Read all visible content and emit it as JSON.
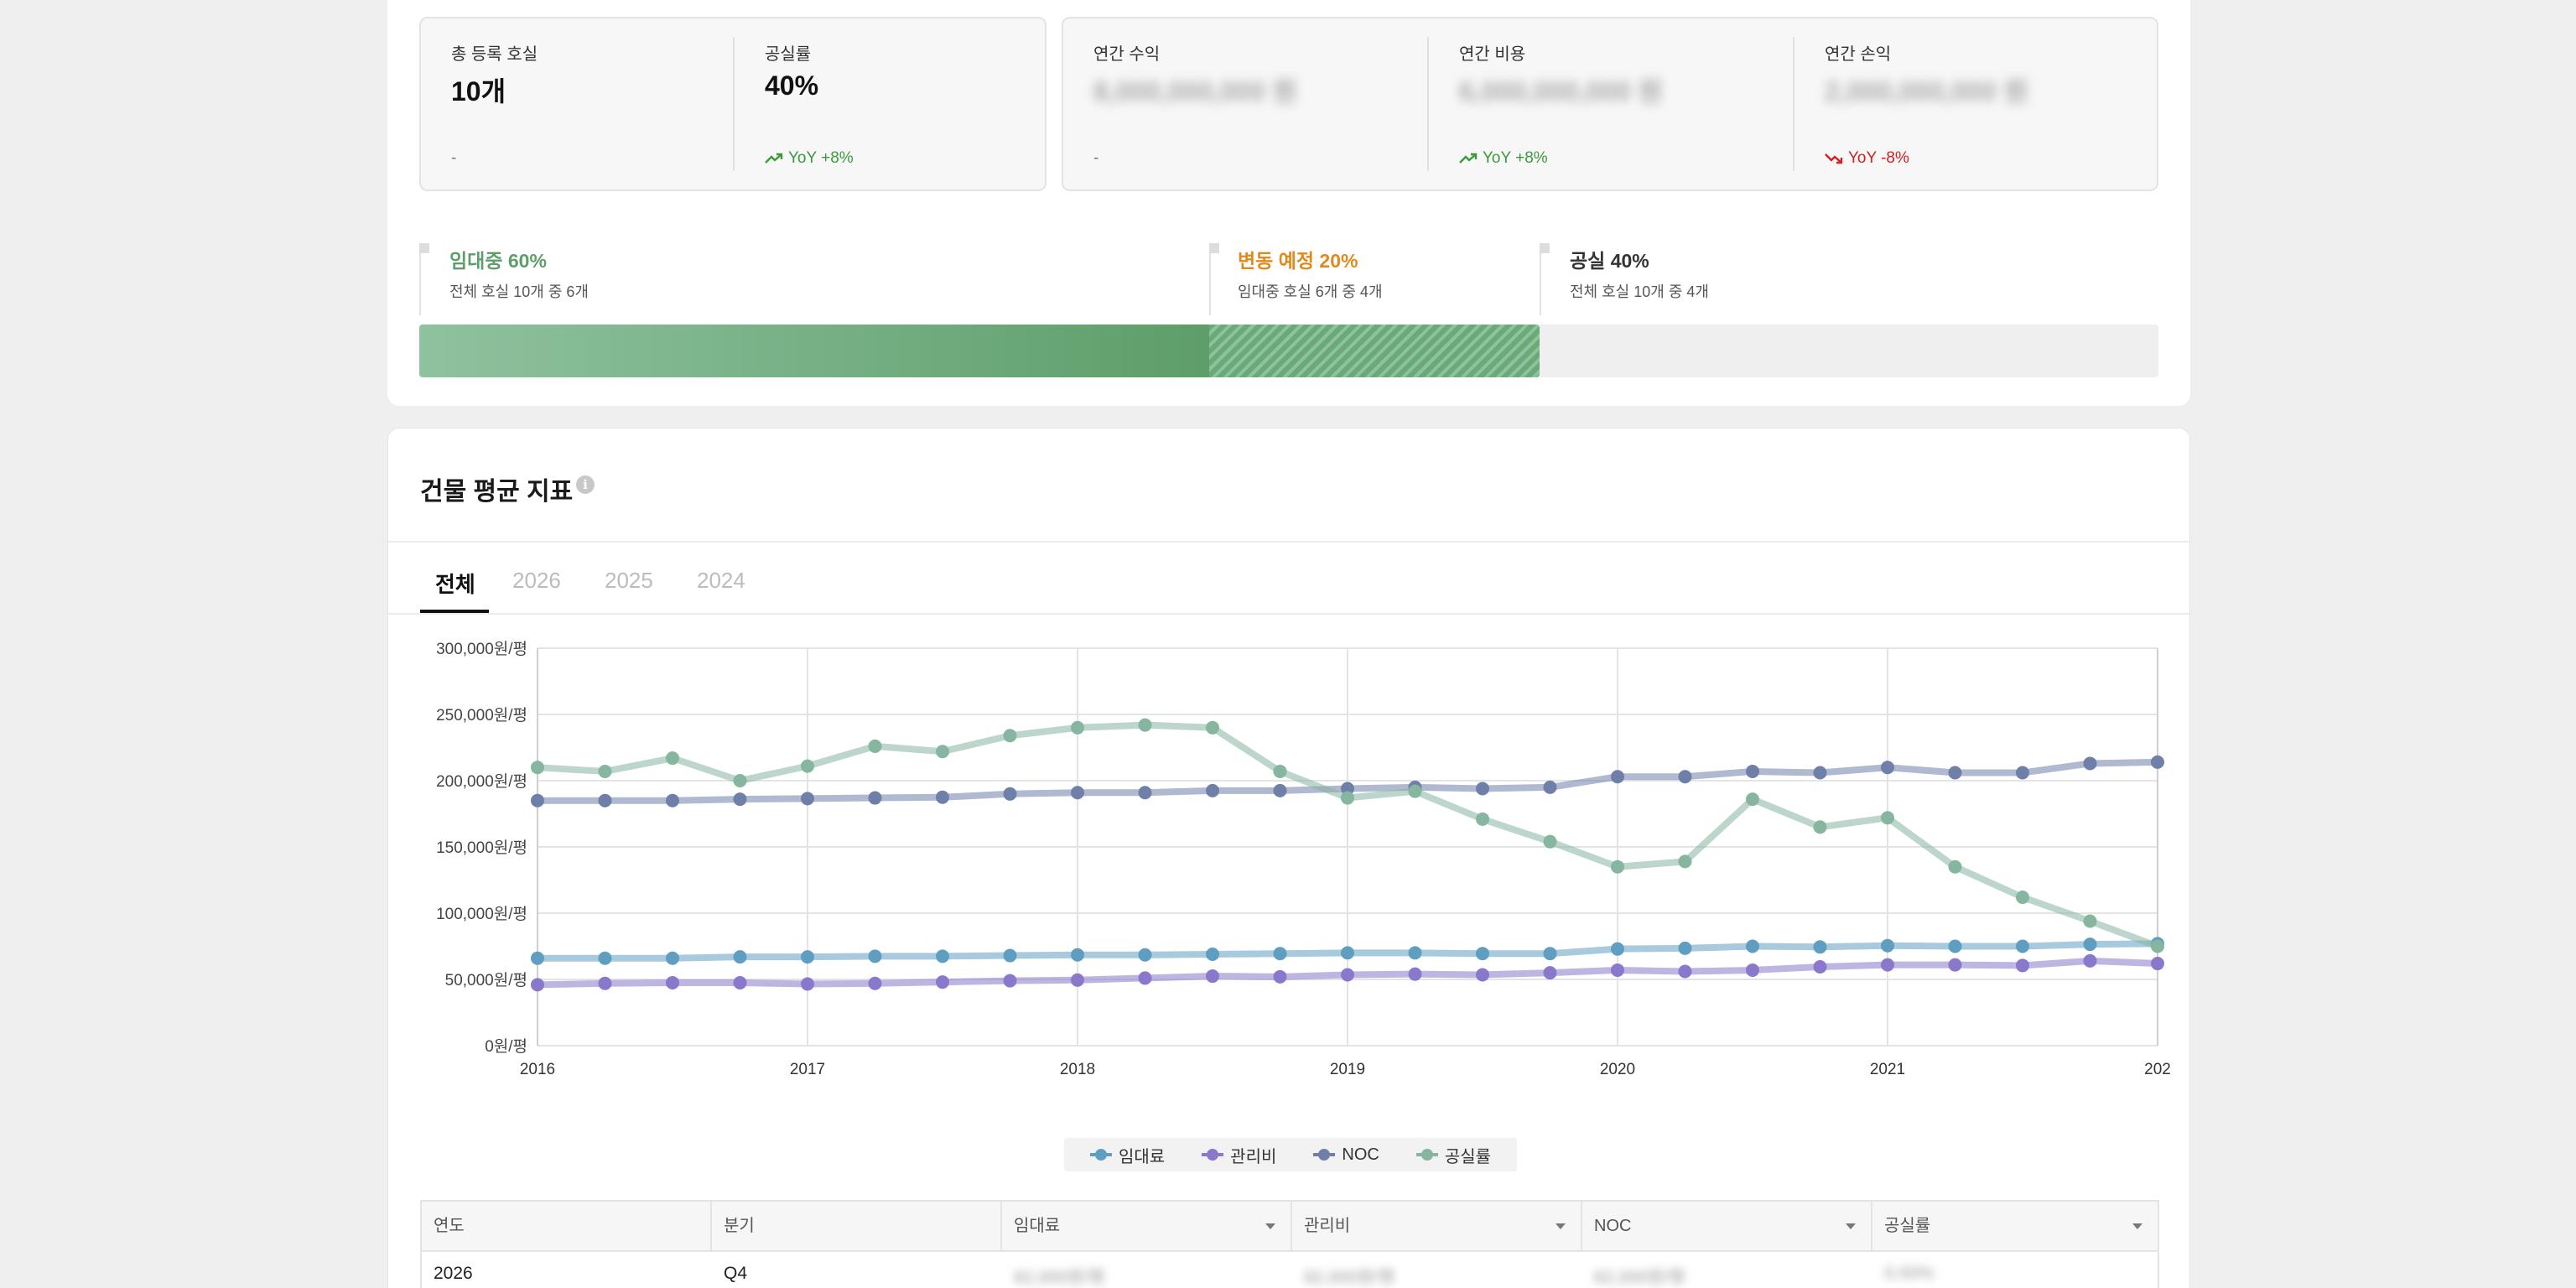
{
  "summary": {
    "registered_units_label": "총 등록 호실",
    "registered_units_value": "10개",
    "registered_units_foot": "-",
    "vacancy_label": "공실률",
    "vacancy_value": "40%",
    "vacancy_foot": "YoY +8%",
    "annual_income_label": "연간 수익",
    "annual_income_value": "8,000,000,000 원",
    "annual_income_foot": "-",
    "annual_cost_label": "연간 비용",
    "annual_cost_value": "6,000,000,000 원",
    "annual_cost_foot": "YoY +8%",
    "annual_pl_label": "연간 손익",
    "annual_pl_value": "2,000,000,000 원",
    "annual_pl_foot": "YoY -8%"
  },
  "occupancy": {
    "leased_title": "임대중 60%",
    "leased_sub": "전체 호실 10개 중 6개",
    "leased_pct": 60,
    "changing_title": "변동 예정 20%",
    "changing_sub": "임대중 호실 6개 중 4개",
    "changing_pct": 20,
    "vacant_title": "공실 40%",
    "vacant_sub": "전체 호실 10개 중 4개",
    "vacant_pct": 40
  },
  "section": {
    "title": "건물 평균 지표",
    "info_icon": "i"
  },
  "tabs": [
    {
      "label": "전체",
      "active": true
    },
    {
      "label": "2026",
      "active": false
    },
    {
      "label": "2025",
      "active": false
    },
    {
      "label": "2024",
      "active": false
    }
  ],
  "chart_data": {
    "type": "line",
    "ylim": [
      0,
      300000
    ],
    "y_ticks": [
      "0원/평",
      "50,000원/평",
      "100,000원/평",
      "150,000원/평",
      "200,000원/평",
      "250,000원/평",
      "300,000원/평"
    ],
    "x_ticks": [
      "2016",
      "2017",
      "2018",
      "2019",
      "2020",
      "2021",
      "202"
    ],
    "x": [
      2016.0,
      2016.25,
      2016.5,
      2016.75,
      2017.0,
      2017.25,
      2017.5,
      2017.75,
      2018.0,
      2018.25,
      2018.5,
      2018.75,
      2019.0,
      2019.25,
      2019.5,
      2019.75,
      2020.0,
      2020.25,
      2020.5,
      2020.75,
      2021.0,
      2021.25,
      2021.5,
      2021.75,
      2022.0
    ],
    "series": [
      {
        "name": "임대료",
        "color": "#5f9ec0",
        "values": [
          66000,
          66000,
          66000,
          67000,
          67000,
          67500,
          67500,
          68000,
          68500,
          68500,
          69000,
          69500,
          70000,
          70000,
          69500,
          69500,
          73000,
          73500,
          75000,
          74500,
          75500,
          75000,
          75000,
          76500,
          77000
        ]
      },
      {
        "name": "관리비",
        "color": "#8a78cc",
        "values": [
          46000,
          47000,
          47500,
          47500,
          46500,
          47000,
          48000,
          49000,
          49500,
          51000,
          52500,
          52000,
          53500,
          54000,
          53500,
          55000,
          57000,
          56000,
          57000,
          59500,
          61000,
          61000,
          60500,
          64000,
          62000
        ]
      },
      {
        "name": "NOC",
        "color": "#6e7fa8",
        "values": [
          185000,
          185000,
          185000,
          186000,
          186500,
          187000,
          187500,
          190000,
          191000,
          191000,
          192500,
          192500,
          194000,
          195000,
          194000,
          195000,
          203000,
          203000,
          207000,
          206000,
          210000,
          206000,
          206000,
          213000,
          214000
        ]
      },
      {
        "name": "공실률",
        "color": "#86b5a0",
        "values": [
          210000,
          207000,
          217000,
          200000,
          211000,
          226000,
          222000,
          234000,
          240000,
          242000,
          240000,
          207000,
          187000,
          192000,
          171000,
          154000,
          135000,
          139000,
          186000,
          165000,
          172000,
          135000,
          112000,
          94000,
          75000
        ]
      }
    ]
  },
  "table": {
    "columns": [
      "연도",
      "분기",
      "임대료",
      "관리비",
      "NOC",
      "공실률"
    ],
    "rows": [
      [
        "2026",
        "Q4",
        "82,000원/평",
        "82,000원/평",
        "82,000원/평",
        "0.00%"
      ]
    ]
  },
  "colors": {
    "leased": "#5e9e6a",
    "changing": "#e08a1e",
    "up": "#3a9a3a",
    "down": "#d42020"
  }
}
